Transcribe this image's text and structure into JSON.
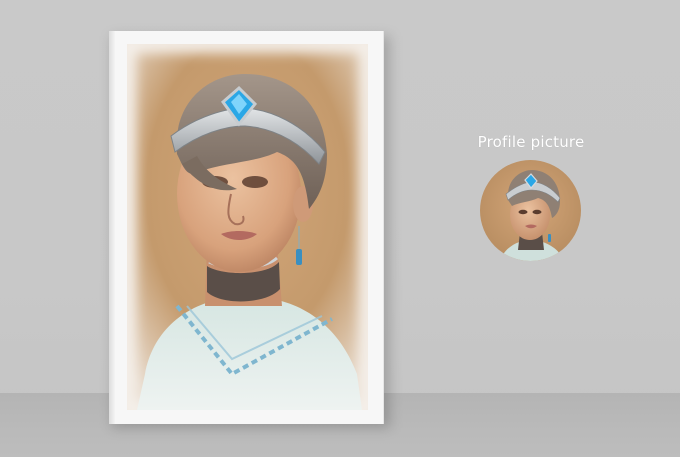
{
  "profile": {
    "caption": "Profile picture"
  },
  "colors": {
    "wall": "#c9c9c9",
    "floor": "#b8b8b8",
    "frame": "#f7f7f7",
    "portrait_background": "#c49a6c",
    "hair": "#8a7a6c",
    "skin": "#e2b08c",
    "tiara": "#bfc3c6",
    "gem": "#2aa7e6",
    "collar": "#5a4e48",
    "garment": "#c8dcd8",
    "garment_trim": "#7fb6cf"
  }
}
